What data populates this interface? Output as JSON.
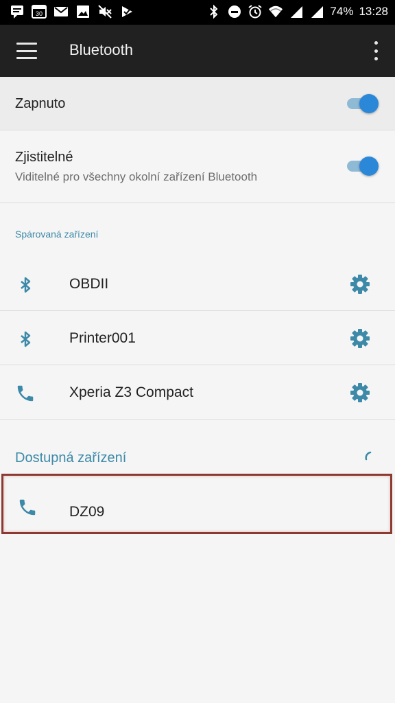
{
  "status_bar": {
    "battery": "74%",
    "time": "13:28",
    "left_icons": [
      "message-icon",
      "calendar-icon",
      "gmail-icon",
      "gallery-icon",
      "muted-icon",
      "play-store-icon"
    ],
    "right_icons": [
      "bluetooth-icon",
      "dnd-icon",
      "alarm-icon",
      "wifi-icon",
      "signal-icon",
      "signal-icon"
    ],
    "calendar_day": "30"
  },
  "app_bar": {
    "title": "Bluetooth",
    "menu_icon": "hamburger-menu-icon",
    "overflow_icon": "more-vert-icon"
  },
  "settings": {
    "enabled_label": "Zapnuto",
    "enabled": true,
    "discoverable_label": "Zjistitelné",
    "discoverable_sub": "Viditelné pro všechny okolní zařízení Bluetooth",
    "discoverable": true
  },
  "paired": {
    "header": "Spárovaná zařízení",
    "devices": [
      {
        "name": "OBDII",
        "icon": "bluetooth-icon"
      },
      {
        "name": "Printer001",
        "icon": "bluetooth-icon"
      },
      {
        "name": "Xperia Z3 Compact",
        "icon": "phone-icon"
      }
    ]
  },
  "available": {
    "header": "Dostupná zařízení",
    "devices": [
      {
        "name": "DZ09",
        "icon": "phone-icon"
      }
    ]
  },
  "colors": {
    "accent": "#2b88d8",
    "section": "#3d8aa8",
    "icon_teal": "#3d8aa8",
    "highlight_border": "#8b3a32"
  }
}
